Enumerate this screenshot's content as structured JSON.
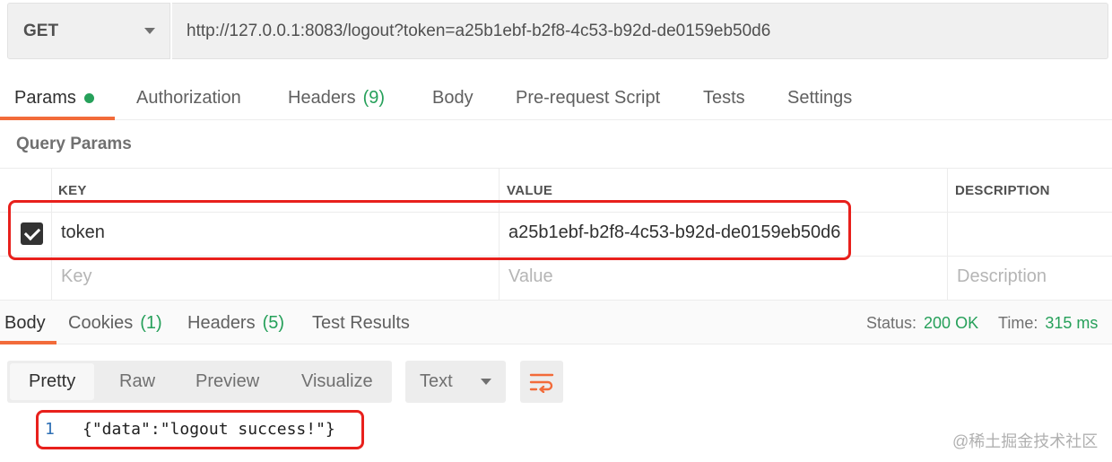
{
  "request": {
    "method": "GET",
    "url": "http://127.0.0.1:8083/logout?token=a25b1ebf-b2f8-4c53-b92d-de0159eb50d6"
  },
  "request_tabs": [
    {
      "label": "Params",
      "count": "",
      "active": true
    },
    {
      "label": "Authorization",
      "count": ""
    },
    {
      "label": "Headers",
      "count": "(9)"
    },
    {
      "label": "Body",
      "count": ""
    },
    {
      "label": "Pre-request Script",
      "count": ""
    },
    {
      "label": "Tests",
      "count": ""
    },
    {
      "label": "Settings",
      "count": ""
    }
  ],
  "query_params": {
    "title": "Query Params",
    "columns": [
      "KEY",
      "VALUE",
      "DESCRIPTION"
    ],
    "rows": [
      {
        "checked": true,
        "key": "token",
        "value": "a25b1ebf-b2f8-4c53-b92d-de0159eb50d6",
        "description": ""
      }
    ],
    "placeholders": {
      "key": "Key",
      "value": "Value",
      "description": "Description"
    }
  },
  "response_tabs": [
    {
      "label": "Body",
      "count": "",
      "active": true
    },
    {
      "label": "Cookies",
      "count": "(1)"
    },
    {
      "label": "Headers",
      "count": "(5)"
    },
    {
      "label": "Test Results",
      "count": ""
    }
  ],
  "response_status": {
    "status_label": "Status:",
    "status_value": "200 OK",
    "time_label": "Time:",
    "time_value": "315 ms"
  },
  "response_view": {
    "modes": [
      "Pretty",
      "Raw",
      "Preview",
      "Visualize"
    ],
    "format": "Text"
  },
  "response_body": {
    "line_number": "1",
    "text": "{\"data\":\"logout success!\"}"
  },
  "watermark": "@稀土掘金技术社区",
  "colors": {
    "accent": "#f26b3a",
    "success": "#26a05a",
    "highlight": "#e8201c"
  }
}
